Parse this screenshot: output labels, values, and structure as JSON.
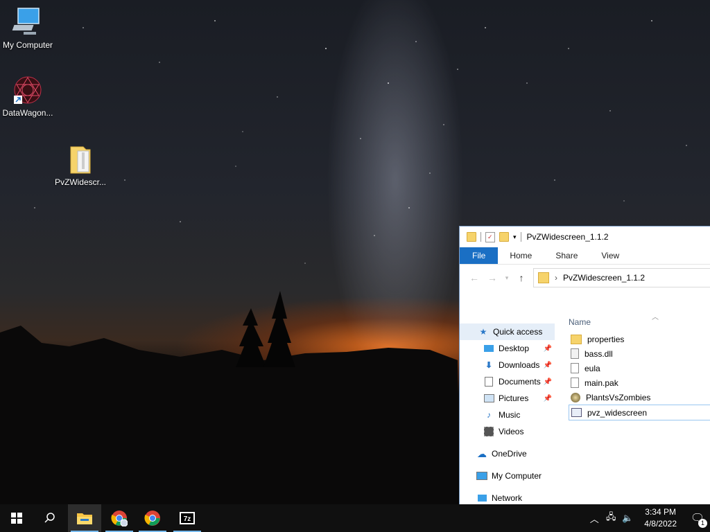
{
  "desktop": {
    "icons": [
      {
        "label": "My Computer",
        "icon": "computer-icon"
      },
      {
        "label": "DataWagon...",
        "icon": "datawagon-icon"
      },
      {
        "label": "PvZWidescr...",
        "icon": "zip-folder-icon"
      }
    ]
  },
  "explorer": {
    "title": "PvZWidescreen_1.1.2",
    "ribbon_tabs": [
      "File",
      "Home",
      "Share",
      "View"
    ],
    "address": "PvZWidescreen_1.1.2",
    "nav": {
      "quick_access": "Quick access",
      "pinned": [
        "Desktop",
        "Downloads",
        "Documents",
        "Pictures"
      ],
      "unpinned": [
        "Music",
        "Videos"
      ],
      "onedrive": "OneDrive",
      "my_computer": "My Computer",
      "network": "Network"
    },
    "column_name": "Name",
    "files": [
      {
        "name": "properties",
        "type": "folder"
      },
      {
        "name": "bass.dll",
        "type": "dll"
      },
      {
        "name": "eula",
        "type": "doc"
      },
      {
        "name": "main.pak",
        "type": "doc"
      },
      {
        "name": "PlantsVsZombies",
        "type": "exe"
      },
      {
        "name": "pvz_widescreen",
        "type": "app"
      }
    ]
  },
  "taskbar": {
    "time": "3:34 PM",
    "date": "4/8/2022",
    "notification_count": "1",
    "apps": [
      "file-explorer-icon",
      "chrome-profile-icon",
      "chrome-icon",
      "7zip-icon"
    ]
  },
  "colors": {
    "accent": "#1a6fc4",
    "taskbar": "#101010",
    "selection": "#e5eef8"
  }
}
